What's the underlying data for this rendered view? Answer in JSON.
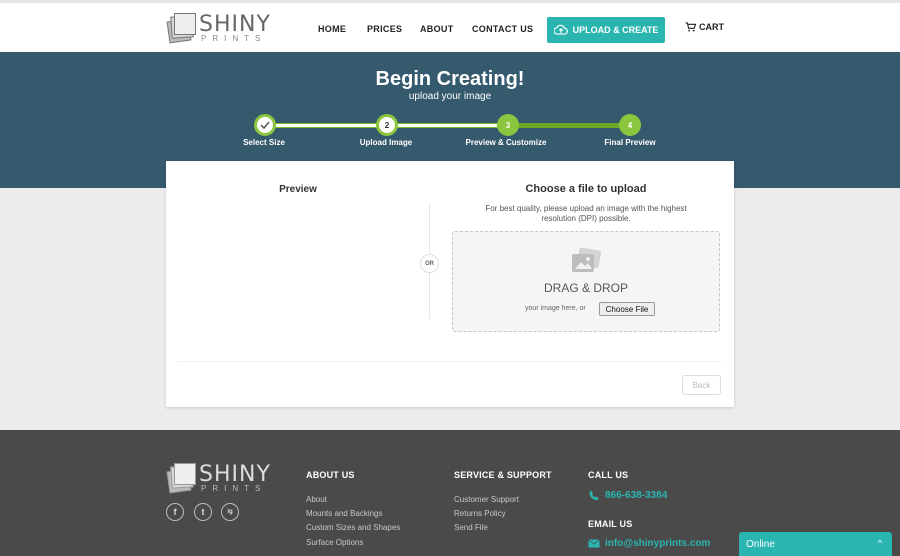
{
  "header": {
    "logo_word": "SHINY",
    "logo_sub": "PRINTS",
    "nav": [
      "HOME",
      "PRICES",
      "ABOUT",
      "CONTACT US"
    ],
    "upload_label": "UPLOAD & CREATE",
    "cart_label": "CART",
    "accent": "#2bb5b0"
  },
  "hero": {
    "title": "Begin Creating!",
    "subtitle": "upload your image",
    "steps": [
      {
        "number": "",
        "label": "Select Size",
        "state": "done"
      },
      {
        "number": "2",
        "label": "Upload Image",
        "state": "current"
      },
      {
        "number": "3",
        "label": "Preview & Customize",
        "state": "todo"
      },
      {
        "number": "4",
        "label": "Final Preview",
        "state": "todo"
      }
    ],
    "background": "#35596d",
    "step_color": "#8cc63f"
  },
  "card": {
    "preview_title": "Preview",
    "or_label": "OR",
    "choose_title": "Choose a file to upload",
    "quality_note": "For best quality, please upload an image with the highest resolution (DPI) possible.",
    "dz_title": "DRAG & DROP",
    "dz_hint": "your image here, or",
    "choose_file": "Choose File",
    "back_label": "Back"
  },
  "footer": {
    "logo_word": "SHINY",
    "logo_sub": "PRINTS",
    "social": [
      "f",
      "t",
      "ig"
    ],
    "about_head": "ABOUT US",
    "about_links": [
      "About",
      "Mounts and Backings",
      "Custom Sizes and Shapes",
      "Surface Options"
    ],
    "service_head": "SERVICE & SUPPORT",
    "service_links": [
      "Customer Support",
      "Returns Policy",
      "Send File"
    ],
    "call_head": "CALL US",
    "phone": "866-638-3384",
    "email_head": "EMAIL US",
    "email": "info@shinyprints.com"
  },
  "chat": {
    "label": "Online",
    "chevron": "^"
  }
}
